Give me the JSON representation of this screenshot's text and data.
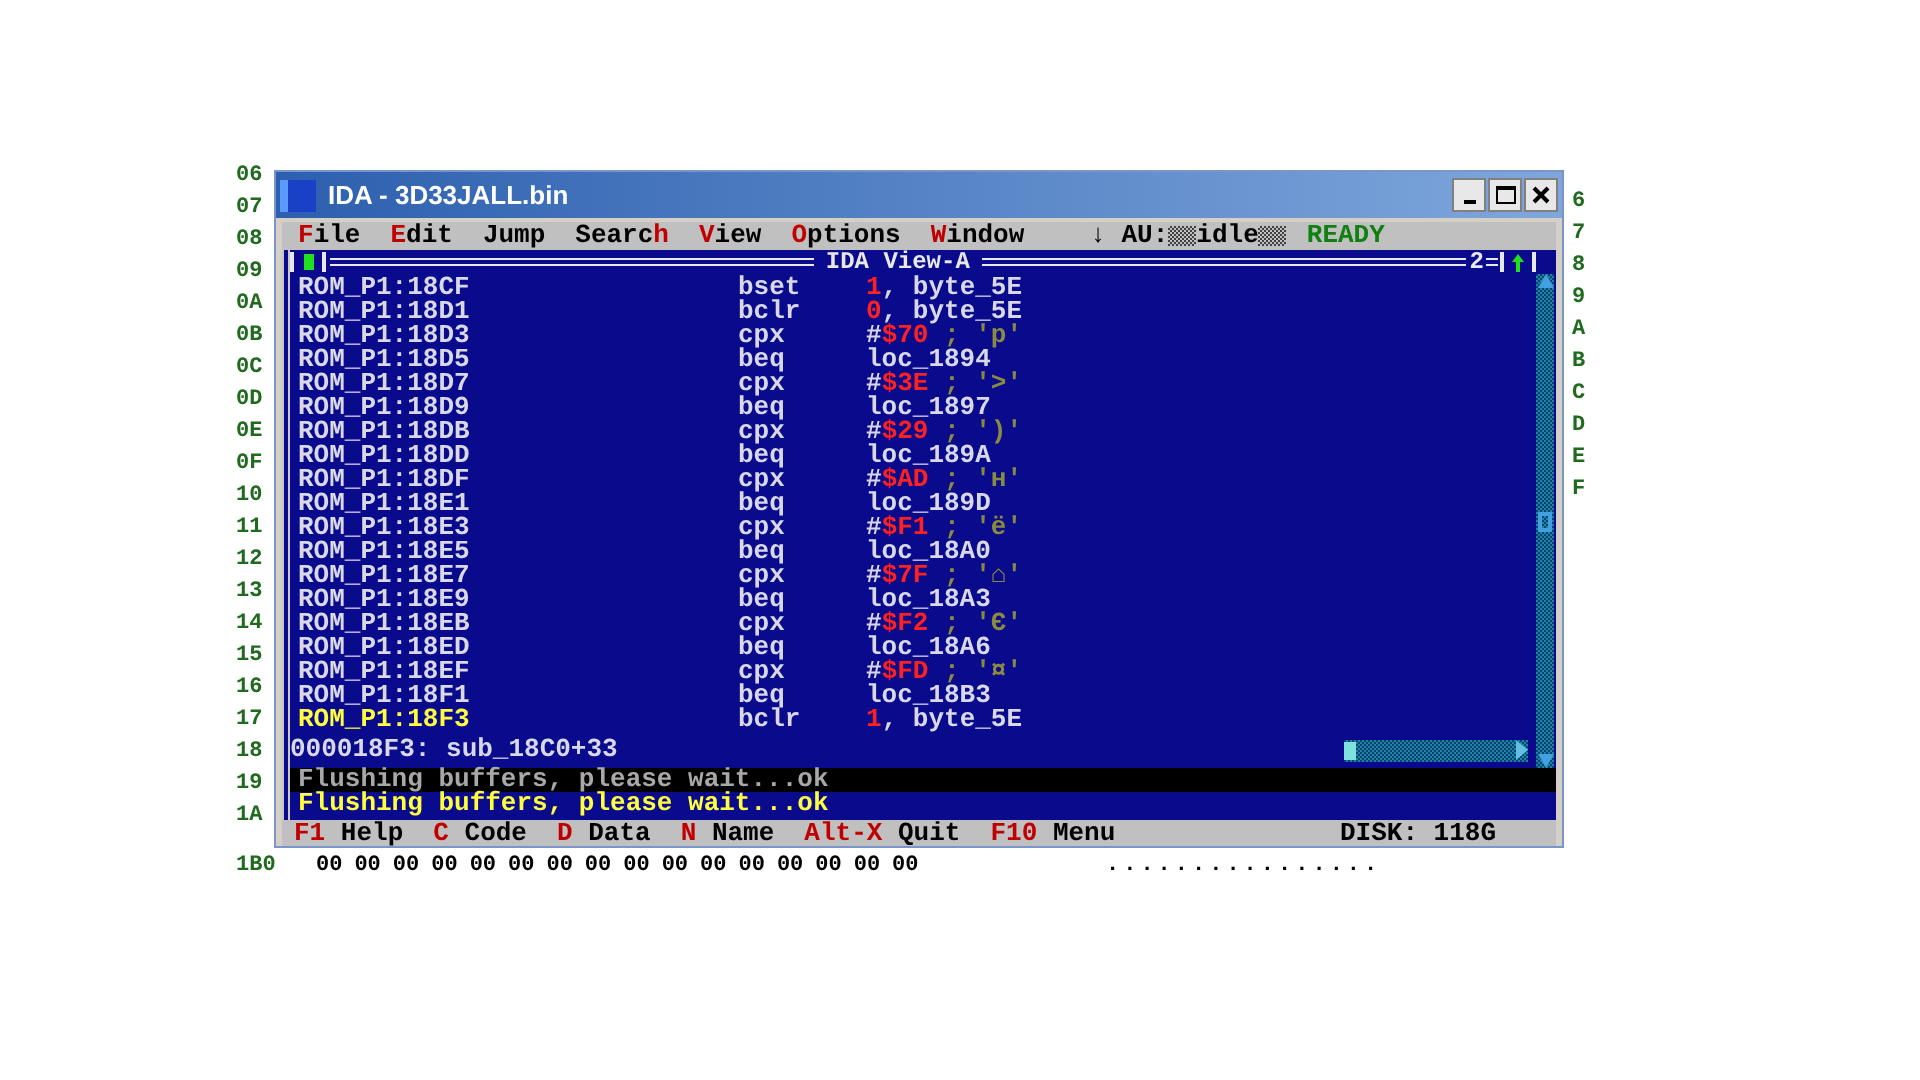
{
  "background_dump": {
    "left_labels": [
      "06",
      "07",
      "08",
      "09",
      "0A",
      "0B",
      "0C",
      "0D",
      "0E",
      "0F",
      "10",
      "11",
      "12",
      "13",
      "14",
      "15",
      "16",
      "17",
      "18",
      "19",
      "1A"
    ],
    "right_labels": [
      "6",
      "7",
      "8",
      "9",
      "A",
      "B",
      "C",
      "D",
      "E",
      "F"
    ],
    "bottom_row": {
      "address": "1B0",
      "bytes": [
        "00",
        "00",
        "00",
        "00",
        "00",
        "00",
        "00",
        "00",
        "00",
        "00",
        "00",
        "00",
        "00",
        "00",
        "00",
        "00"
      ],
      "ascii": "................"
    }
  },
  "window": {
    "title": "IDA - 3D33JALL.bin"
  },
  "menu": [
    {
      "key": "F",
      "post": "ile"
    },
    {
      "key": "E",
      "post": "dit"
    },
    {
      "pre": "Jump"
    },
    {
      "pre": "Searc",
      "key": "h"
    },
    {
      "key": "V",
      "post": "iew"
    },
    {
      "key": "O",
      "post": "ptions"
    },
    {
      "key": "W",
      "post": "indow"
    }
  ],
  "status": {
    "prefix": "↓ AU:",
    "indicator": "idle",
    "state": "READY"
  },
  "view": {
    "title": "IDA View-A",
    "number": "2",
    "rows": [
      {
        "address": "ROM_P1:18CF",
        "mnemonic": "bset",
        "operand": [
          {
            "kind": "num",
            "text": "1"
          },
          {
            "kind": "text",
            "text": ", byte_5E"
          }
        ],
        "selected": false
      },
      {
        "address": "ROM_P1:18D1",
        "mnemonic": "bclr",
        "operand": [
          {
            "kind": "num",
            "text": "0"
          },
          {
            "kind": "text",
            "text": ", byte_5E"
          }
        ],
        "selected": false
      },
      {
        "address": "ROM_P1:18D3",
        "mnemonic": "cpx",
        "operand": [
          {
            "kind": "text",
            "text": "#"
          },
          {
            "kind": "num",
            "text": "$70"
          },
          {
            "kind": "comment",
            "text": " ; 'p'"
          }
        ],
        "selected": false
      },
      {
        "address": "ROM_P1:18D5",
        "mnemonic": "beq",
        "operand": [
          {
            "kind": "text",
            "text": "loc_1894"
          }
        ],
        "selected": false
      },
      {
        "address": "ROM_P1:18D7",
        "mnemonic": "cpx",
        "operand": [
          {
            "kind": "text",
            "text": "#"
          },
          {
            "kind": "num",
            "text": "$3E"
          },
          {
            "kind": "comment",
            "text": " ; '>'"
          }
        ],
        "selected": false
      },
      {
        "address": "ROM_P1:18D9",
        "mnemonic": "beq",
        "operand": [
          {
            "kind": "text",
            "text": "loc_1897"
          }
        ],
        "selected": false
      },
      {
        "address": "ROM_P1:18DB",
        "mnemonic": "cpx",
        "operand": [
          {
            "kind": "text",
            "text": "#"
          },
          {
            "kind": "num",
            "text": "$29"
          },
          {
            "kind": "comment",
            "text": " ; ')'"
          }
        ],
        "selected": false
      },
      {
        "address": "ROM_P1:18DD",
        "mnemonic": "beq",
        "operand": [
          {
            "kind": "text",
            "text": "loc_189A"
          }
        ],
        "selected": false
      },
      {
        "address": "ROM_P1:18DF",
        "mnemonic": "cpx",
        "operand": [
          {
            "kind": "text",
            "text": "#"
          },
          {
            "kind": "num",
            "text": "$AD"
          },
          {
            "kind": "comment",
            "text": " ; 'н'"
          }
        ],
        "selected": false
      },
      {
        "address": "ROM_P1:18E1",
        "mnemonic": "beq",
        "operand": [
          {
            "kind": "text",
            "text": "loc_189D"
          }
        ],
        "selected": false
      },
      {
        "address": "ROM_P1:18E3",
        "mnemonic": "cpx",
        "operand": [
          {
            "kind": "text",
            "text": "#"
          },
          {
            "kind": "num",
            "text": "$F1"
          },
          {
            "kind": "comment",
            "text": " ; 'ё'"
          }
        ],
        "selected": false
      },
      {
        "address": "ROM_P1:18E5",
        "mnemonic": "beq",
        "operand": [
          {
            "kind": "text",
            "text": "loc_18A0"
          }
        ],
        "selected": false
      },
      {
        "address": "ROM_P1:18E7",
        "mnemonic": "cpx",
        "operand": [
          {
            "kind": "text",
            "text": "#"
          },
          {
            "kind": "num",
            "text": "$7F"
          },
          {
            "kind": "comment",
            "text": " ; '⌂'"
          }
        ],
        "selected": false
      },
      {
        "address": "ROM_P1:18E9",
        "mnemonic": "beq",
        "operand": [
          {
            "kind": "text",
            "text": "loc_18A3"
          }
        ],
        "selected": false
      },
      {
        "address": "ROM_P1:18EB",
        "mnemonic": "cpx",
        "operand": [
          {
            "kind": "text",
            "text": "#"
          },
          {
            "kind": "num",
            "text": "$F2"
          },
          {
            "kind": "comment",
            "text": " ; 'Є'"
          }
        ],
        "selected": false
      },
      {
        "address": "ROM_P1:18ED",
        "mnemonic": "beq",
        "operand": [
          {
            "kind": "text",
            "text": "loc_18A6"
          }
        ],
        "selected": false
      },
      {
        "address": "ROM_P1:18EF",
        "mnemonic": "cpx",
        "operand": [
          {
            "kind": "text",
            "text": "#"
          },
          {
            "kind": "num",
            "text": "$FD"
          },
          {
            "kind": "comment",
            "text": " ; '¤'"
          }
        ],
        "selected": false
      },
      {
        "address": "ROM_P1:18F1",
        "mnemonic": "beq",
        "operand": [
          {
            "kind": "text",
            "text": "loc_18B3"
          }
        ],
        "selected": false
      },
      {
        "address": "ROM_P1:18F3",
        "mnemonic": "bclr",
        "operand": [
          {
            "kind": "num",
            "text": "1"
          },
          {
            "kind": "text",
            "text": ", byte_5E"
          }
        ],
        "selected": true
      }
    ],
    "location": "000018F3: sub_18C0+33"
  },
  "messages": [
    {
      "text": "Flushing buffers, please wait...ok",
      "selected": true
    },
    {
      "text": "Flushing buffers, please wait...ok",
      "selected": false
    }
  ],
  "function_keys": [
    {
      "key": "F1",
      "label": "Help"
    },
    {
      "key": "C",
      "label": "Code"
    },
    {
      "key": "D",
      "label": "Data"
    },
    {
      "key": "N",
      "label": "Name"
    },
    {
      "key": "Alt-X",
      "label": "Quit"
    },
    {
      "key": "F10",
      "label": "Menu"
    }
  ],
  "disk": "DISK: 118G"
}
